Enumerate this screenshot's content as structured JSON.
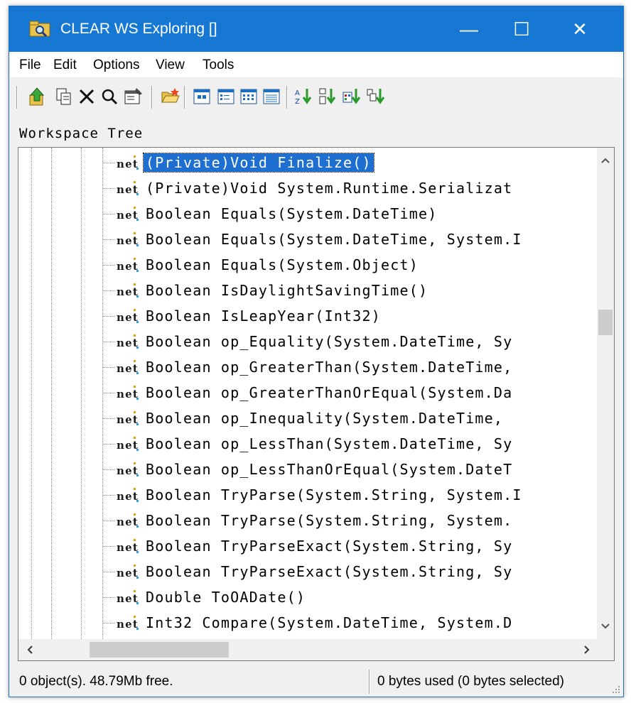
{
  "window": {
    "title": "CLEAR WS Exploring []",
    "minimize_glyph": "—",
    "maximize_glyph": "☐",
    "close_glyph": "✕"
  },
  "menu": {
    "items": [
      {
        "label": "File"
      },
      {
        "label": "Edit"
      },
      {
        "label": "Options"
      },
      {
        "label": "View"
      },
      {
        "label": "Tools"
      }
    ]
  },
  "toolbar": {
    "icons": [
      "go-up-icon",
      "copy-icon",
      "delete-icon",
      "find-icon",
      "properties-icon",
      "open-folder-icon",
      "large-icons-view-icon",
      "small-icons-view-icon",
      "list-view-icon",
      "details-view-icon",
      "sort-by-name-icon",
      "sort-by-type-icon",
      "sort-by-size-icon",
      "sort-by-date-icon"
    ]
  },
  "panel": {
    "label": "Workspace Tree"
  },
  "tree": {
    "icon_label": "net",
    "rows": [
      {
        "text": "(Private)Void Finalize()",
        "selected": true
      },
      {
        "text": "(Private)Void System.Runtime.Serializat"
      },
      {
        "text": "Boolean Equals(System.DateTime)"
      },
      {
        "text": "Boolean Equals(System.DateTime, System.I"
      },
      {
        "text": "Boolean Equals(System.Object)"
      },
      {
        "text": "Boolean IsDaylightSavingTime()"
      },
      {
        "text": "Boolean IsLeapYear(Int32)"
      },
      {
        "text": "Boolean op_Equality(System.DateTime, Sy"
      },
      {
        "text": "Boolean op_GreaterThan(System.DateTime,"
      },
      {
        "text": "Boolean op_GreaterThanOrEqual(System.Da"
      },
      {
        "text": "Boolean op_Inequality(System.DateTime,"
      },
      {
        "text": "Boolean op_LessThan(System.DateTime, Sy"
      },
      {
        "text": "Boolean op_LessThanOrEqual(System.DateT"
      },
      {
        "text": "Boolean TryParse(System.String, System.I"
      },
      {
        "text": "Boolean TryParse(System.String, System."
      },
      {
        "text": "Boolean TryParseExact(System.String, Sy"
      },
      {
        "text": "Boolean TryParseExact(System.String, Sy"
      },
      {
        "text": "Double ToOADate()"
      },
      {
        "text": "Int32 Compare(System.DateTime, System.D"
      }
    ]
  },
  "status": {
    "left": "0 object(s). 48.79Mb free.",
    "right": "0 bytes used (0 bytes selected)"
  },
  "colors": {
    "titlebar": "#1778d3",
    "selection": "#1f6fd0"
  }
}
